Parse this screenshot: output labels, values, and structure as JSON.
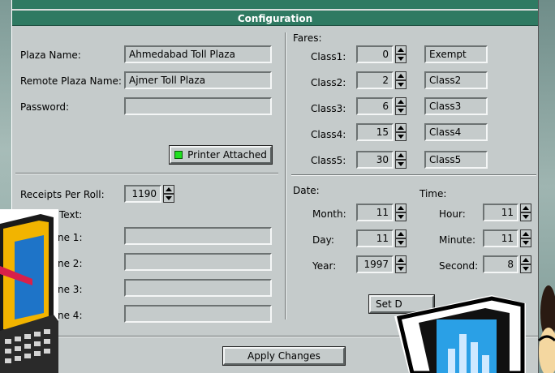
{
  "window": {
    "title": "Configuration"
  },
  "plaza": {
    "name_label": "Plaza Name:",
    "name_value": "Ahmedabad Toll Plaza",
    "remote_label": "Remote Plaza Name:",
    "remote_value": "Ajmer Toll Plaza",
    "password_label": "Password:",
    "password_value": "",
    "printer_label": "Printer Attached",
    "printer_attached": true
  },
  "fares": {
    "heading": "Fares:",
    "rows": [
      {
        "label": "Class1:",
        "amount": "0",
        "name": "Exempt"
      },
      {
        "label": "Class2:",
        "amount": "2",
        "name": "Class2"
      },
      {
        "label": "Class3:",
        "amount": "6",
        "name": "Class3"
      },
      {
        "label": "Class4:",
        "amount": "15",
        "name": "Class4"
      },
      {
        "label": "Class5:",
        "amount": "30",
        "name": "Class5"
      }
    ]
  },
  "receipts": {
    "per_roll_label": "Receipts Per Roll:",
    "per_roll_value": "1190",
    "text_label": "Text:",
    "lines": [
      {
        "label": "ne 1:",
        "value": ""
      },
      {
        "label": "ne 2:",
        "value": ""
      },
      {
        "label": "ne 3:",
        "value": ""
      },
      {
        "label": "ne 4:",
        "value": ""
      }
    ]
  },
  "date": {
    "heading": "Date:",
    "month_label": "Month:",
    "month_value": "11",
    "day_label": "Day:",
    "day_value": "11",
    "year_label": "Year:",
    "year_value": "1997"
  },
  "time": {
    "heading": "Time:",
    "hour_label": "Hour:",
    "hour_value": "11",
    "minute_label": "Minute:",
    "minute_value": "11",
    "second_label": "Second:",
    "second_value": "8"
  },
  "buttons": {
    "set_date_label": "Set D",
    "apply_label": "Apply Changes"
  },
  "colors": {
    "titlebar": "#2f7a62",
    "panel": "#c5cbcb",
    "led": "#20e020"
  }
}
